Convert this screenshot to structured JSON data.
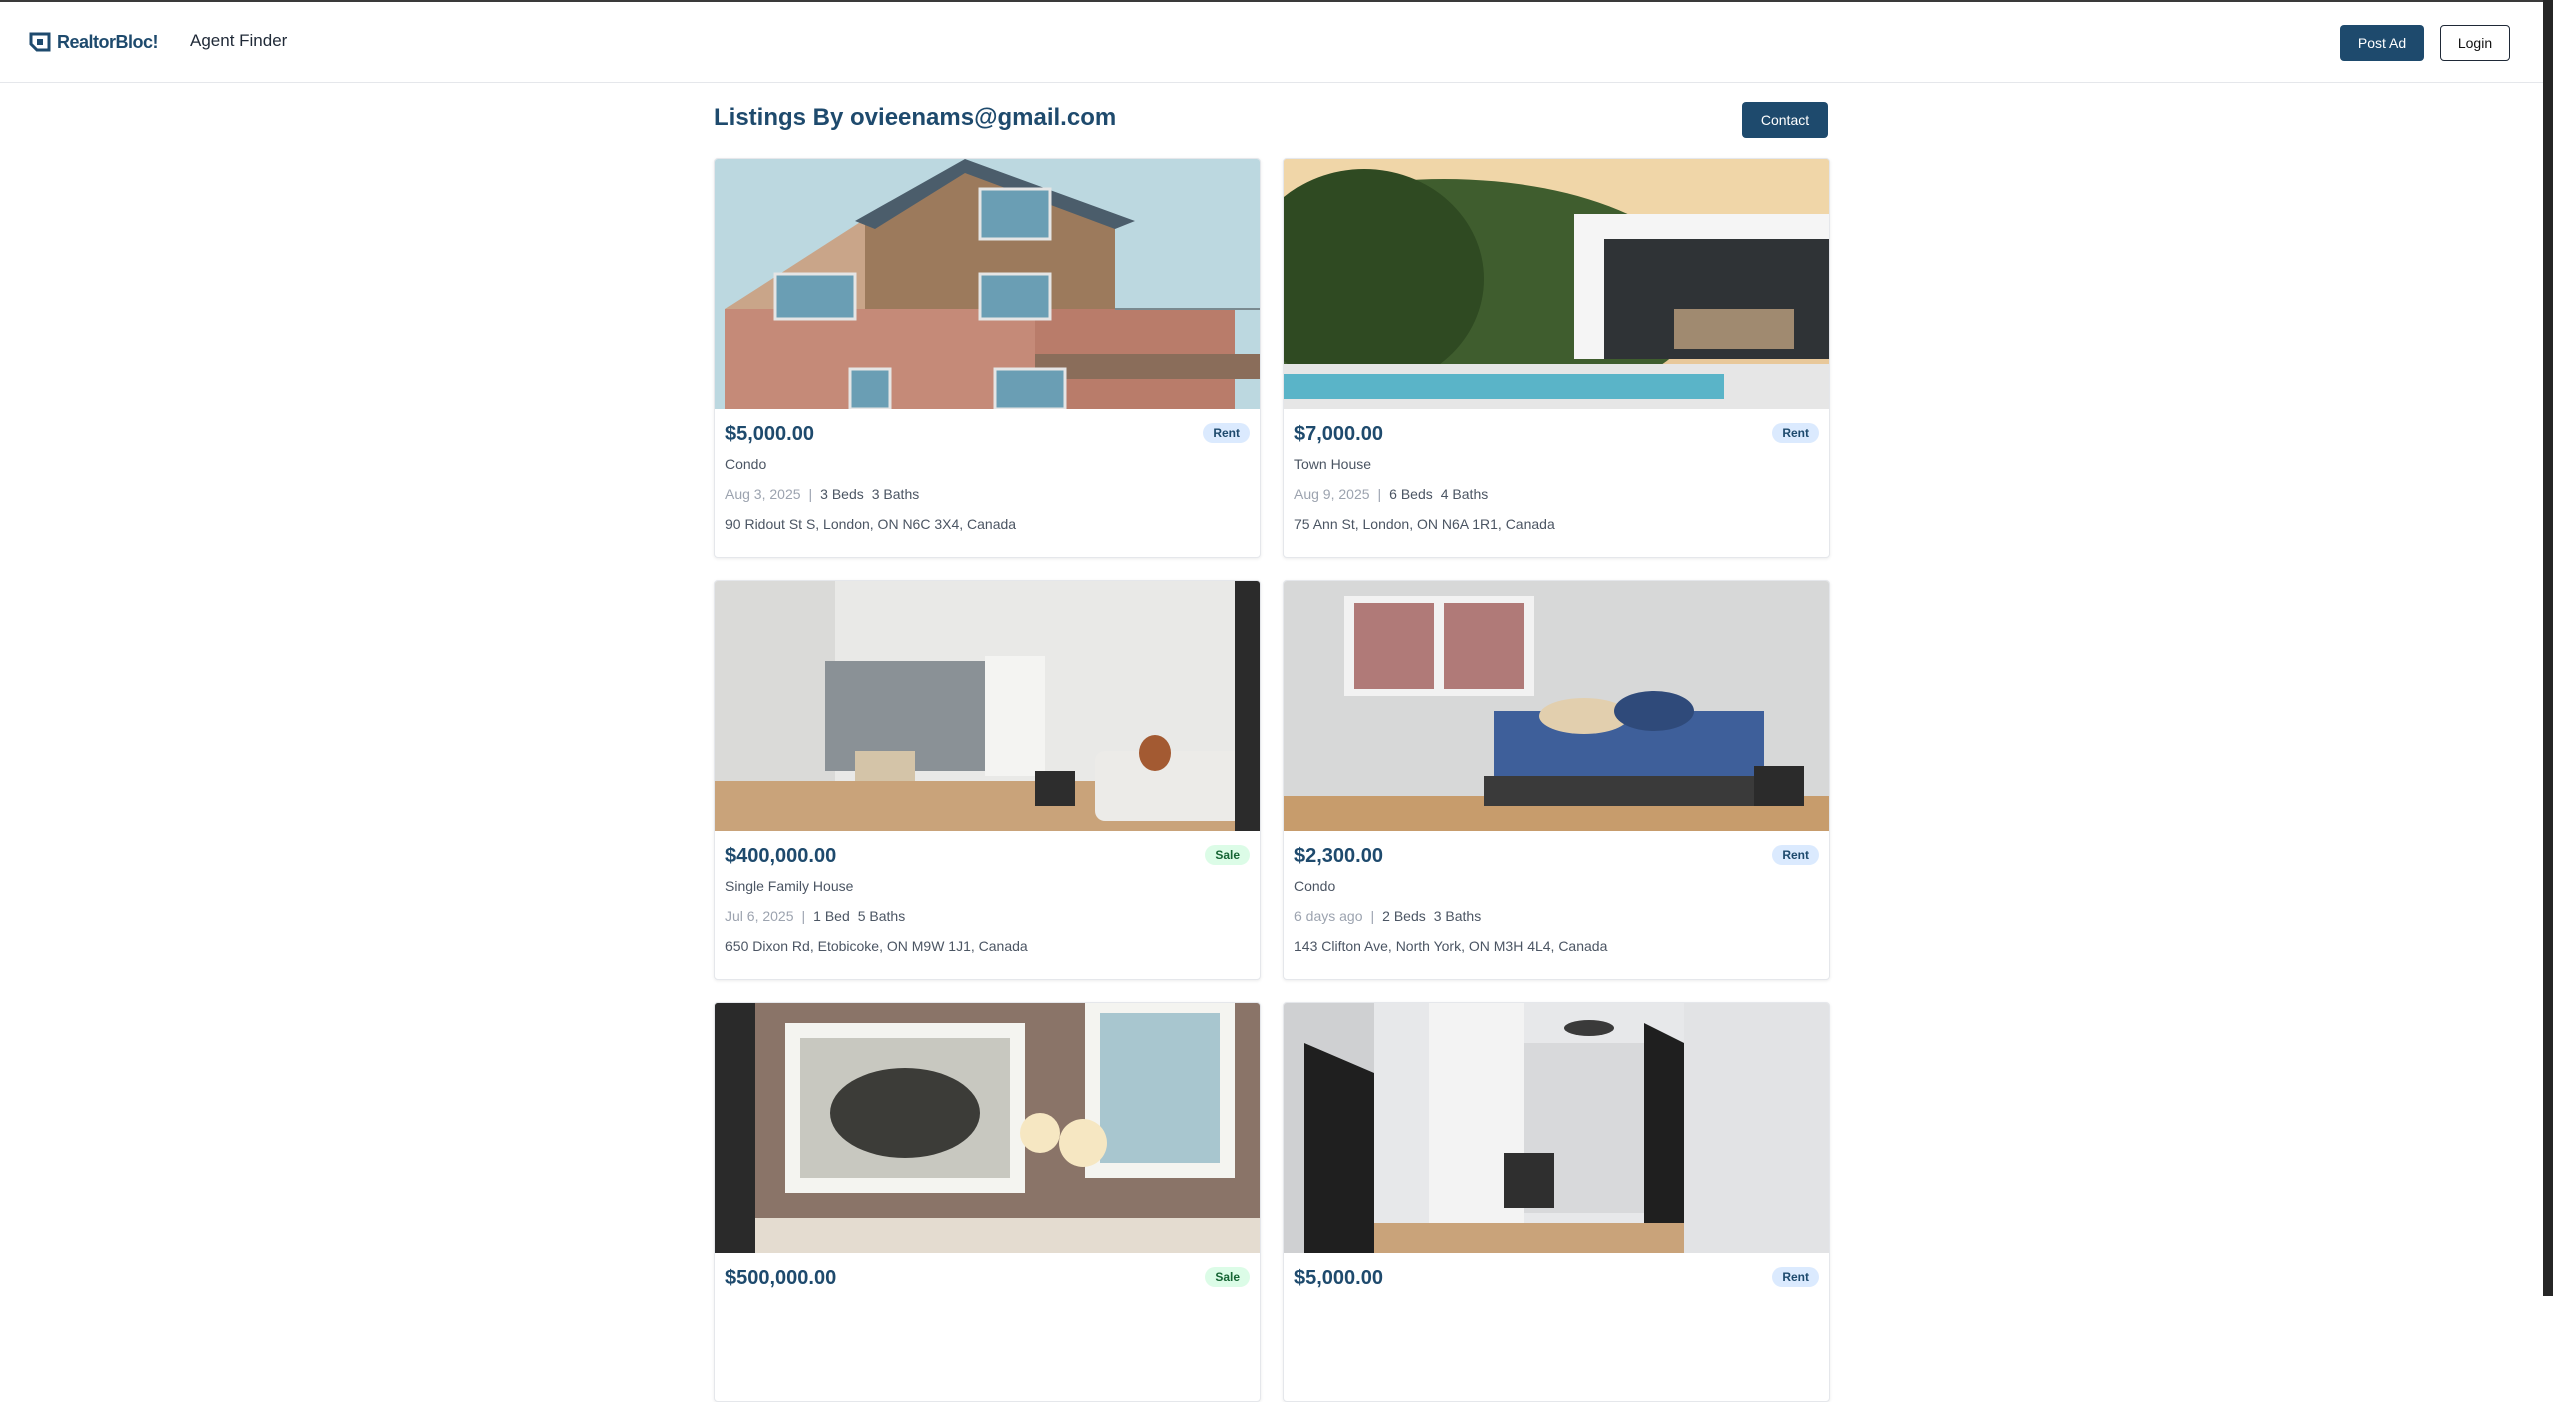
{
  "brand": {
    "name": "RealtorBloc!",
    "logo_icon": "realtorbloc-logo-icon"
  },
  "nav": {
    "agent_finder": "Agent Finder"
  },
  "header_actions": {
    "post_ad": "Post Ad",
    "login": "Login"
  },
  "page": {
    "title": "Listings By ovieenams@gmail.com",
    "contact": "Contact"
  },
  "colors": {
    "brand": "#1e4a6d",
    "rent_badge": "#dbeafe",
    "sale_badge": "#dcfce7"
  },
  "listings": [
    {
      "price": "$5,000.00",
      "badge": "Rent",
      "type": "Condo",
      "date": "Aug 3, 2025",
      "sep": "|",
      "beds": "3 Beds",
      "baths": "3 Baths",
      "address": "90 Ridout St S, London, ON N6C 3X4, Canada",
      "photo": "house-exterior-photo"
    },
    {
      "price": "$7,000.00",
      "badge": "Rent",
      "type": "Town House",
      "date": "Aug 9, 2025",
      "sep": "|",
      "beds": "6 Beds",
      "baths": "4 Baths",
      "address": "75 Ann St, London, ON N6A 1R1, Canada",
      "photo": "pool-patio-photo"
    },
    {
      "price": "$400,000.00",
      "badge": "Sale",
      "type": "Single Family House",
      "date": "Jul 6, 2025",
      "sep": "|",
      "beds": "1 Bed",
      "baths": "5 Baths",
      "address": "650 Dixon Rd, Etobicoke, ON M9W 1J1, Canada",
      "photo": "living-room-photo"
    },
    {
      "price": "$2,300.00",
      "badge": "Rent",
      "type": "Condo",
      "date": "6 days ago",
      "sep": "|",
      "beds": "2 Beds",
      "baths": "3 Baths",
      "address": "143 Clifton Ave, North York, ON M3H 4L4, Canada",
      "photo": "bedroom-photo"
    },
    {
      "price": "$500,000.00",
      "badge": "Sale",
      "photo": "art-wall-photo"
    },
    {
      "price": "$5,000.00",
      "badge": "Rent",
      "photo": "hallway-photo"
    }
  ]
}
